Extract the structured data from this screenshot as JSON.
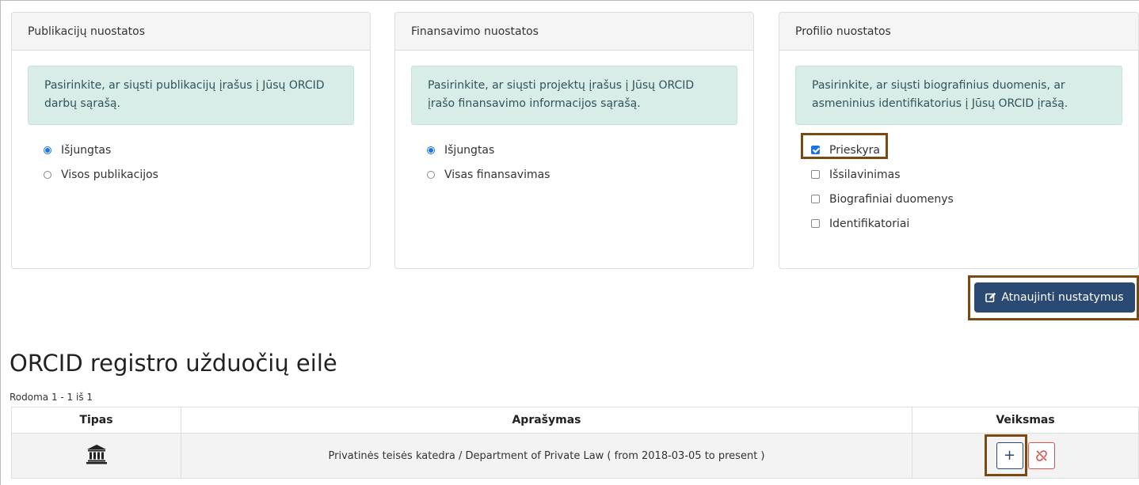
{
  "panels": [
    {
      "heading": "Publikacijų nuostatos",
      "info": "Pasirinkite, ar siųsti publikacijų įrašus į Jūsų ORCID darbų sąrašą.",
      "options": [
        {
          "label": "Išjungtas",
          "selected": true
        },
        {
          "label": "Visos publikacijos",
          "selected": false
        }
      ]
    },
    {
      "heading": "Finansavimo nuostatos",
      "info": "Pasirinkite, ar siųsti projektų įrašus į Jūsų ORCID įrašo finansavimo informacijos sąrašą.",
      "options": [
        {
          "label": "Išjungtas",
          "selected": true
        },
        {
          "label": "Visas finansavimas",
          "selected": false
        }
      ]
    },
    {
      "heading": "Profilio nuostatos",
      "info": "Pasirinkite, ar siųsti biografinius duomenis, ar asmeninius identifikatorius į Jūsų ORCID įrašą.",
      "options": [
        {
          "label": "Prieskyra",
          "checked": true
        },
        {
          "label": "Išsilavinimas",
          "checked": false
        },
        {
          "label": "Biografiniai duomenys",
          "checked": false
        },
        {
          "label": "Identifikatoriai",
          "checked": false
        }
      ]
    }
  ],
  "update_button": {
    "label": "Atnaujinti nustatymus",
    "icon": "edit-icon"
  },
  "queue": {
    "title": "ORCID registro užduočių eilė",
    "showing": "Rodoma 1 - 1 iš 1",
    "columns": [
      "Tipas",
      "Aprašymas",
      "Veiksmas"
    ],
    "rows": [
      {
        "type_icon": "institution-icon",
        "description": "Privatinės teisės katedra / Department of Private Law ( from 2018-03-05 to present )",
        "add_label": "+"
      }
    ]
  },
  "colors": {
    "primary": "#2b4a73",
    "info_bg": "#d9ede8",
    "danger": "#d9534f",
    "highlight": "#7a4a12",
    "radio_accent": "#1a73e8"
  }
}
